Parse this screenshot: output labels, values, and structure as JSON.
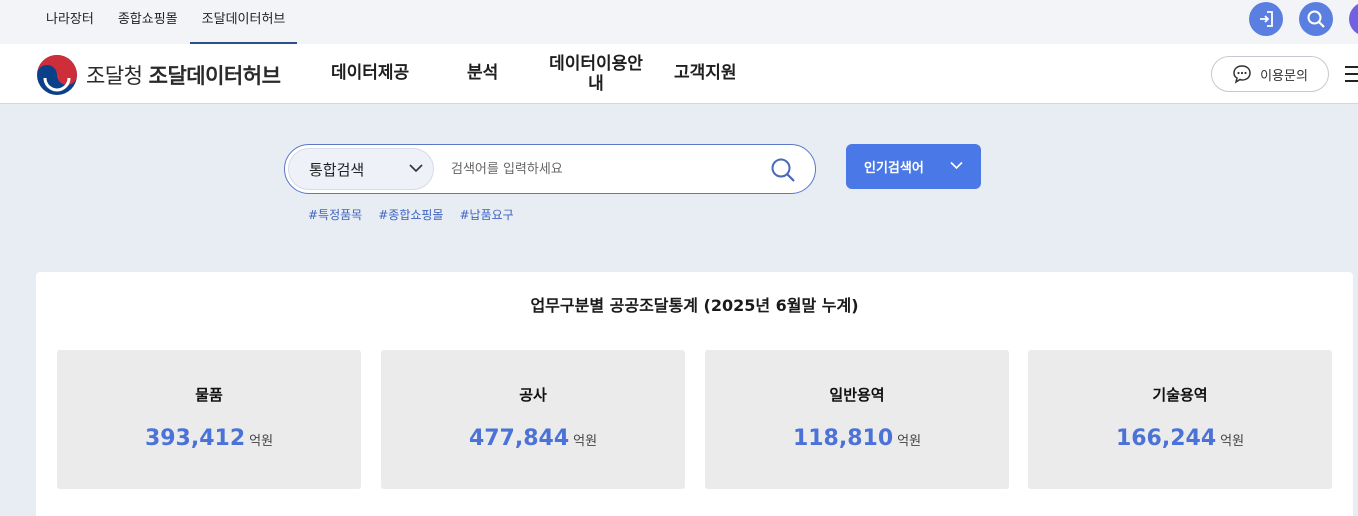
{
  "top_links": [
    "나라장터",
    "종합쇼핑몰",
    "조달데이터허브"
  ],
  "top_active_index": 2,
  "icons": {
    "login": "login-icon",
    "search": "search-icon",
    "profile": "profile-icon"
  },
  "brand": {
    "org": "조달청",
    "name": "조달데이터허브"
  },
  "nav": [
    "데이터제공",
    "분석",
    "데이터이용안내",
    "고객지원"
  ],
  "inquiry_label": "이용문의",
  "search": {
    "category": "통합검색",
    "placeholder": "검색어를 입력하세요",
    "popular_label": "인기검색어",
    "tags": [
      "#특정품목",
      "#종합쇼핑몰",
      "#납품요구"
    ]
  },
  "stats": {
    "title": "업무구분별 공공조달통계 (2025년 6월말 누계)",
    "cards": [
      {
        "label": "물품",
        "value": "393,412",
        "unit": "억원"
      },
      {
        "label": "공사",
        "value": "477,844",
        "unit": "억원"
      },
      {
        "label": "일반용역",
        "value": "118,810",
        "unit": "억원"
      },
      {
        "label": "기술용역",
        "value": "166,244",
        "unit": "억원"
      }
    ]
  },
  "colors": {
    "accent": "#4a78e6",
    "stat_number": "#4a72d8",
    "background": "#e8ecf3"
  }
}
